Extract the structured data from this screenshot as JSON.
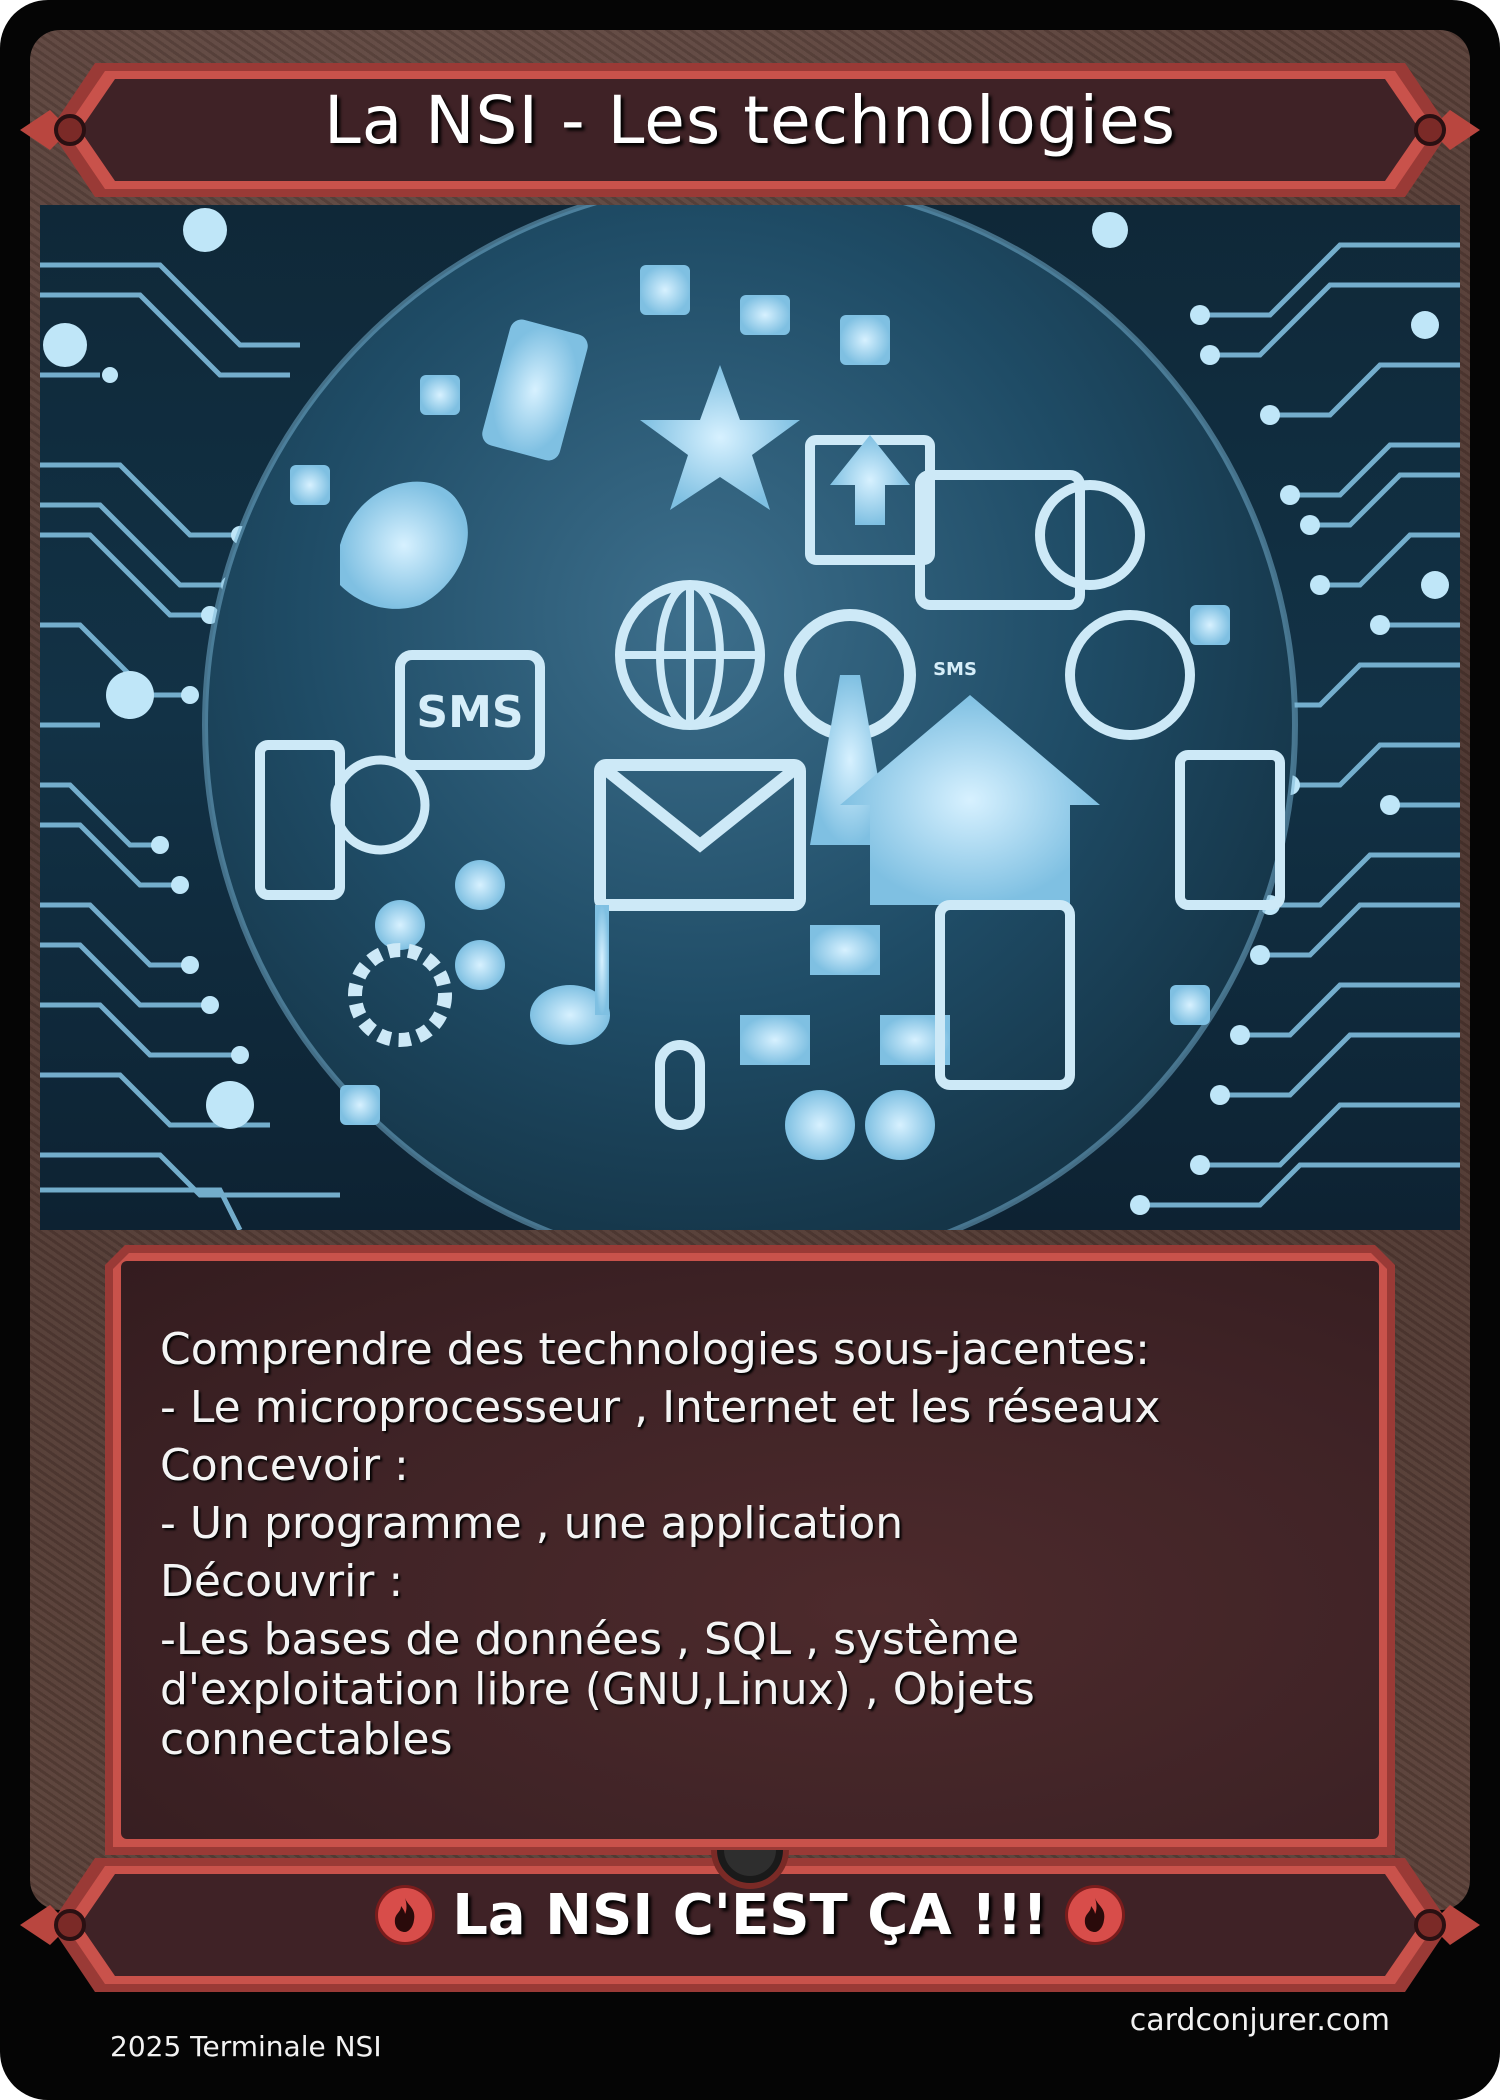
{
  "card": {
    "title": "La NSI - Les technologies",
    "art": {
      "sms_label": "SMS",
      "sms_small_label": "SMS"
    },
    "rules_text": [
      "Comprendre des technologies sous-jacentes:",
      "- Le microprocesseur , Internet et les réseaux",
      "Concevoir :",
      "- Un programme , une application",
      "Découvrir :",
      "-Les bases de données , SQL , système",
      "d'exploitation libre (GNU,Linux) , Objets",
      "connectables"
    ],
    "bottom_banner": "La NSI C'EST ÇA !!!",
    "bottom_icon": "fire-icon",
    "footer_left": "2025 Terminale NSI",
    "footer_right": "cardconjurer.com"
  },
  "colors": {
    "frame_red": "#c24a44",
    "banner_fill": "#3f2226",
    "art_blue": "#8ec6e3",
    "text": "#ffffff"
  }
}
